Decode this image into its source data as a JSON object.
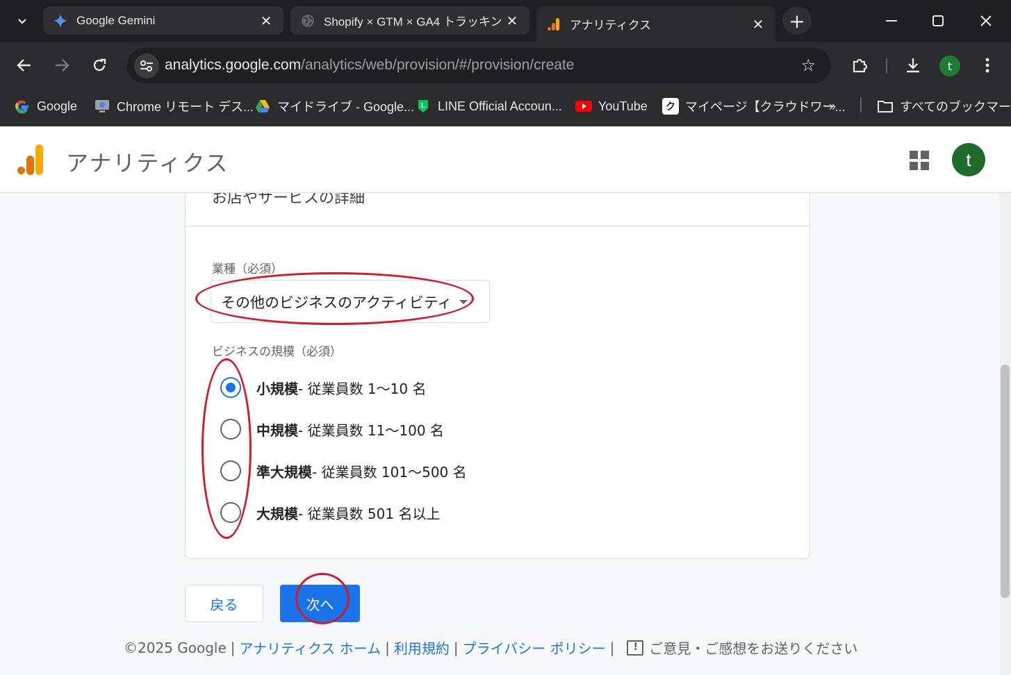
{
  "browser": {
    "tabs": [
      {
        "title": "Google Gemini",
        "icon": "gemini-icon",
        "active": false
      },
      {
        "title": "Shopify × GTM × GA4 トラッキン",
        "icon": "globe-icon",
        "active": false
      },
      {
        "title": "アナリティクス",
        "icon": "analytics-icon",
        "active": true
      }
    ],
    "url_host": "analytics.google.com",
    "url_path": "/analytics/web/provision/#/provision/create",
    "profile_initial": "t",
    "bookmarks": [
      {
        "label": "Google",
        "icon": "google-icon"
      },
      {
        "label": "Chrome リモート デス...",
        "icon": "chrome-remote-icon"
      },
      {
        "label": "マイドライブ - Google...",
        "icon": "drive-icon"
      },
      {
        "label": "LINE Official Accoun...",
        "icon": "line-icon"
      },
      {
        "label": "YouTube",
        "icon": "youtube-icon"
      },
      {
        "label": "マイページ【クラウドワー...",
        "icon": "crowdworks-icon"
      }
    ],
    "more_bookmarks": "»",
    "all_bookmarks": "すべてのブックマーク"
  },
  "app": {
    "title": "アナリティクス",
    "avatar_initial": "t"
  },
  "form": {
    "card_title": "お店やサービスの詳細",
    "industry_label": "業種（必須）",
    "industry_value": "その他のビジネスのアクティビティ",
    "size_label": "ビジネスの規模（必須）",
    "size_options": [
      {
        "bold": "小規模",
        "detail": " - 従業員数 1〜10 名",
        "checked": true
      },
      {
        "bold": "中規模",
        "detail": " - 従業員数 11〜100 名",
        "checked": false
      },
      {
        "bold": "準大規模",
        "detail": " - 従業員数 101〜500 名",
        "checked": false
      },
      {
        "bold": "大規模",
        "detail": " - 従業員数 501 名以上",
        "checked": false
      }
    ],
    "back_label": "戻る",
    "next_label": "次へ"
  },
  "footer": {
    "copyright": "©2025 Google",
    "links": [
      "アナリティクス ホーム",
      "利用規約",
      "プライバシー ポリシー"
    ],
    "feedback": "ご意見・ご感想をお送りください"
  },
  "colors": {
    "accent": "#1a73e8",
    "annotation": "#d11a2a",
    "avatar": "#1e6b2c"
  }
}
